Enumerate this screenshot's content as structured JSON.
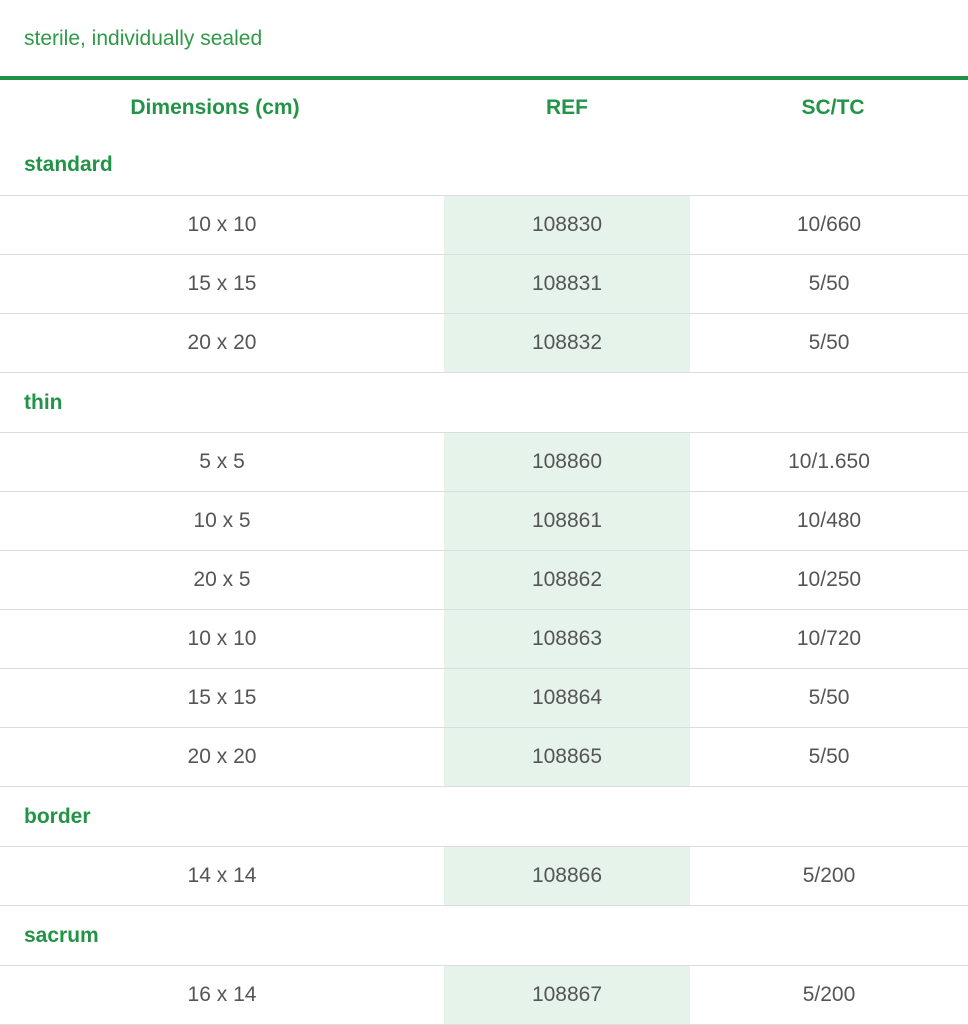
{
  "subtitle": "sterile, individually sealed",
  "columns": {
    "dimensions": "Dimensions (cm)",
    "ref": "REF",
    "sc_tc": "SC/TC"
  },
  "groups": [
    {
      "name": "standard",
      "rows": [
        {
          "dimensions": "10 x 10",
          "ref": "108830",
          "sc_tc": "10/660"
        },
        {
          "dimensions": "15 x 15",
          "ref": "108831",
          "sc_tc": "5/50"
        },
        {
          "dimensions": "20 x 20",
          "ref": "108832",
          "sc_tc": "5/50"
        }
      ]
    },
    {
      "name": "thin",
      "rows": [
        {
          "dimensions": "5 x 5",
          "ref": "108860",
          "sc_tc": "10/1.650"
        },
        {
          "dimensions": "10 x 5",
          "ref": "108861",
          "sc_tc": "10/480"
        },
        {
          "dimensions": "20 x 5",
          "ref": "108862",
          "sc_tc": "10/250"
        },
        {
          "dimensions": "10 x 10",
          "ref": "108863",
          "sc_tc": "10/720"
        },
        {
          "dimensions": "15 x 15",
          "ref": "108864",
          "sc_tc": "5/50"
        },
        {
          "dimensions": "20 x 20",
          "ref": "108865",
          "sc_tc": "5/50"
        }
      ]
    },
    {
      "name": "border",
      "rows": [
        {
          "dimensions": "14 x 14",
          "ref": "108866",
          "sc_tc": "5/200"
        }
      ]
    },
    {
      "name": "sacrum",
      "rows": [
        {
          "dimensions": "16 x 14",
          "ref": "108867",
          "sc_tc": "5/200"
        }
      ]
    }
  ],
  "colors": {
    "brand_green": "#239447",
    "ref_highlight": "#e5f3ea",
    "body_text": "#555555"
  }
}
